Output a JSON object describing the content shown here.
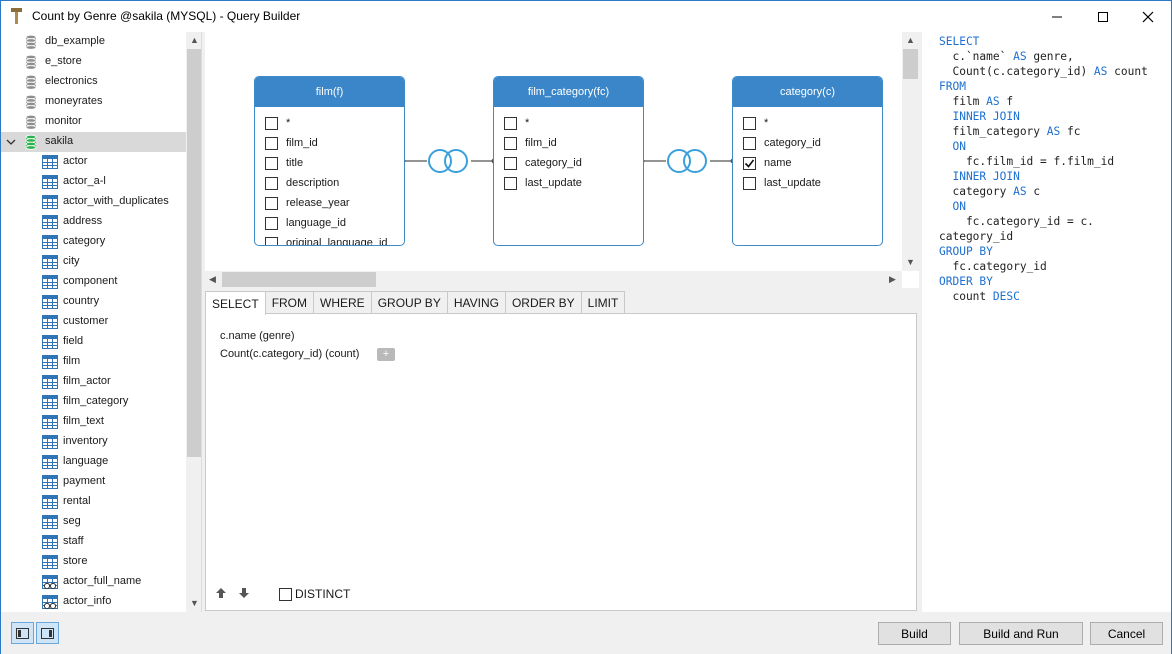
{
  "window": {
    "title": "Count by Genre @sakila (MYSQL) - Query Builder"
  },
  "sidebar": {
    "databases": [
      {
        "label": "db_example"
      },
      {
        "label": "e_store"
      },
      {
        "label": "electronics"
      },
      {
        "label": "moneyrates"
      },
      {
        "label": "monitor"
      },
      {
        "label": "sakila",
        "expanded": true,
        "selected": true
      }
    ],
    "tables": [
      {
        "label": "actor"
      },
      {
        "label": "actor_a-l"
      },
      {
        "label": "actor_with_duplicates"
      },
      {
        "label": "address"
      },
      {
        "label": "category"
      },
      {
        "label": "city"
      },
      {
        "label": "component"
      },
      {
        "label": "country"
      },
      {
        "label": "customer"
      },
      {
        "label": "field"
      },
      {
        "label": "film"
      },
      {
        "label": "film_actor"
      },
      {
        "label": "film_category"
      },
      {
        "label": "film_text"
      },
      {
        "label": "inventory"
      },
      {
        "label": "language"
      },
      {
        "label": "payment"
      },
      {
        "label": "rental"
      },
      {
        "label": "seg"
      },
      {
        "label": "staff"
      },
      {
        "label": "store"
      }
    ],
    "views": [
      {
        "label": "actor_full_name"
      },
      {
        "label": "actor_info"
      }
    ]
  },
  "diagram": {
    "tables": [
      {
        "title": "film(f)",
        "columns": [
          {
            "label": "*",
            "checked": false
          },
          {
            "label": "film_id",
            "checked": false
          },
          {
            "label": "title",
            "checked": false
          },
          {
            "label": "description",
            "checked": false
          },
          {
            "label": "release_year",
            "checked": false
          },
          {
            "label": "language_id",
            "checked": false
          },
          {
            "label": "original_language_id",
            "checked": false
          }
        ]
      },
      {
        "title": "film_category(fc)",
        "columns": [
          {
            "label": "*",
            "checked": false
          },
          {
            "label": "film_id",
            "checked": false
          },
          {
            "label": "category_id",
            "checked": false
          },
          {
            "label": "last_update",
            "checked": false
          }
        ]
      },
      {
        "title": "category(c)",
        "columns": [
          {
            "label": "*",
            "checked": false
          },
          {
            "label": "category_id",
            "checked": false
          },
          {
            "label": "name",
            "checked": true
          },
          {
            "label": "last_update",
            "checked": false
          }
        ]
      }
    ]
  },
  "tabs": [
    {
      "label": "SELECT",
      "active": true
    },
    {
      "label": "FROM"
    },
    {
      "label": "WHERE"
    },
    {
      "label": "GROUP BY"
    },
    {
      "label": "HAVING"
    },
    {
      "label": "ORDER BY"
    },
    {
      "label": "LIMIT"
    }
  ],
  "select_panel": {
    "lines": [
      "c.name  (genre)",
      "Count(c.category_id)  (count)"
    ],
    "add_label": "+",
    "distinct_label": "DISTINCT",
    "distinct_checked": false
  },
  "sql": {
    "lines": [
      [
        [
          "kw",
          "SELECT"
        ]
      ],
      [
        [
          "",
          "  c.`name` "
        ],
        [
          "kw",
          "AS"
        ],
        [
          "",
          " genre,"
        ]
      ],
      [
        [
          "",
          "  Count(c.category_id) "
        ],
        [
          "kw",
          "AS"
        ],
        [
          "",
          " count"
        ]
      ],
      [
        [
          "kw",
          "FROM"
        ]
      ],
      [
        [
          "",
          "  film "
        ],
        [
          "kw",
          "AS"
        ],
        [
          "",
          " f"
        ]
      ],
      [
        [
          "kw",
          "  INNER JOIN"
        ]
      ],
      [
        [
          "",
          "  film_category "
        ],
        [
          "kw",
          "AS"
        ],
        [
          "",
          " fc"
        ]
      ],
      [
        [
          "kw",
          "  ON"
        ]
      ],
      [
        [
          "",
          "    fc.film_id = f.film_id"
        ]
      ],
      [
        [
          "kw",
          "  INNER JOIN"
        ]
      ],
      [
        [
          "",
          "  category "
        ],
        [
          "kw",
          "AS"
        ],
        [
          "",
          " c"
        ]
      ],
      [
        [
          "kw",
          "  ON"
        ]
      ],
      [
        [
          "",
          "    fc.category_id = c."
        ]
      ],
      [
        [
          "",
          "category_id"
        ]
      ],
      [
        [
          "kw",
          "GROUP BY"
        ]
      ],
      [
        [
          "",
          "  fc.category_id"
        ]
      ],
      [
        [
          "kw",
          "ORDER BY"
        ]
      ],
      [
        [
          "",
          "  count "
        ],
        [
          "kw",
          "DESC"
        ]
      ]
    ]
  },
  "buttons": {
    "build": "Build",
    "build_and_run": "Build and Run",
    "cancel": "Cancel"
  },
  "colors": {
    "accent": "#3a86c8",
    "keyword": "#1d6fd1",
    "join_icon": "#3aa0dc",
    "sakila_db": "#2bb24c"
  }
}
